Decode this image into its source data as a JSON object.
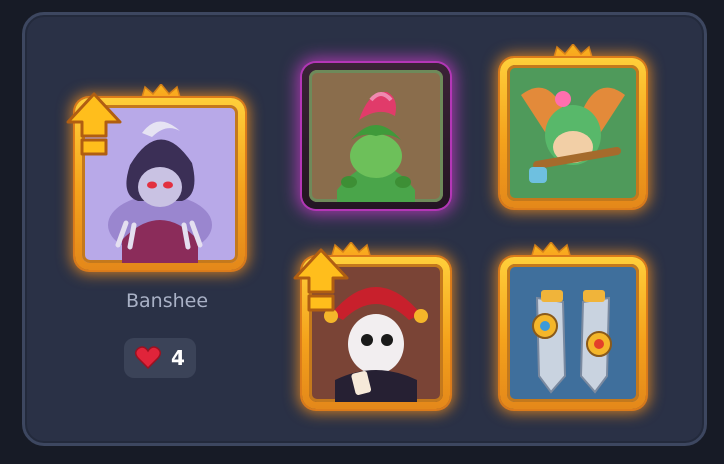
{
  "selected_hero": {
    "name": "Banshee",
    "likes": "4"
  },
  "cards": [
    {
      "id": "banshee",
      "rarity": "legendary",
      "frame": "gold",
      "bg": "#b8a9e8",
      "upgrade_available": true
    },
    {
      "id": "dryad",
      "rarity": "epic",
      "frame": "purple",
      "bg": "#8a6d4c",
      "upgrade_available": false
    },
    {
      "id": "forest-elf",
      "rarity": "legendary",
      "frame": "gold",
      "bg": "#4f9a5b",
      "upgrade_available": false
    },
    {
      "id": "harlequin",
      "rarity": "legendary",
      "frame": "gold",
      "bg": "#7a4436",
      "upgrade_available": true
    },
    {
      "id": "blade-dancer",
      "rarity": "legendary",
      "frame": "gold",
      "bg": "#3f6f9c",
      "upgrade_available": false
    }
  ],
  "colors": {
    "panel_bg": "#2a3146",
    "gold_frame": "#f4a21c",
    "purple_glow": "#c83cc8",
    "heart": "#e0243a"
  },
  "icons": [
    "crown-icon",
    "upgrade-arrow-icon",
    "heart-icon"
  ]
}
